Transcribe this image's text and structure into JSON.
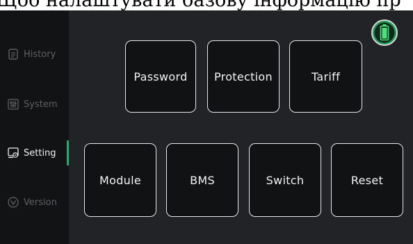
{
  "caption": "Щоб налаштувати базову інформацію пр",
  "sidebar": {
    "items": [
      {
        "label": "History",
        "icon": "history-icon"
      },
      {
        "label": "System",
        "icon": "system-sliders-icon"
      },
      {
        "label": "Setting",
        "icon": "setting-monitor-gear-icon",
        "active": true
      },
      {
        "label": "Version",
        "icon": "version-chevron-circle-icon"
      }
    ]
  },
  "settings": {
    "row1": [
      "Password",
      "Protection",
      "Tariff"
    ],
    "row2": [
      "Module",
      "BMS",
      "Switch",
      "Reset"
    ]
  },
  "status": {
    "battery_icon": "battery-icon",
    "accent": "#19b36b"
  }
}
